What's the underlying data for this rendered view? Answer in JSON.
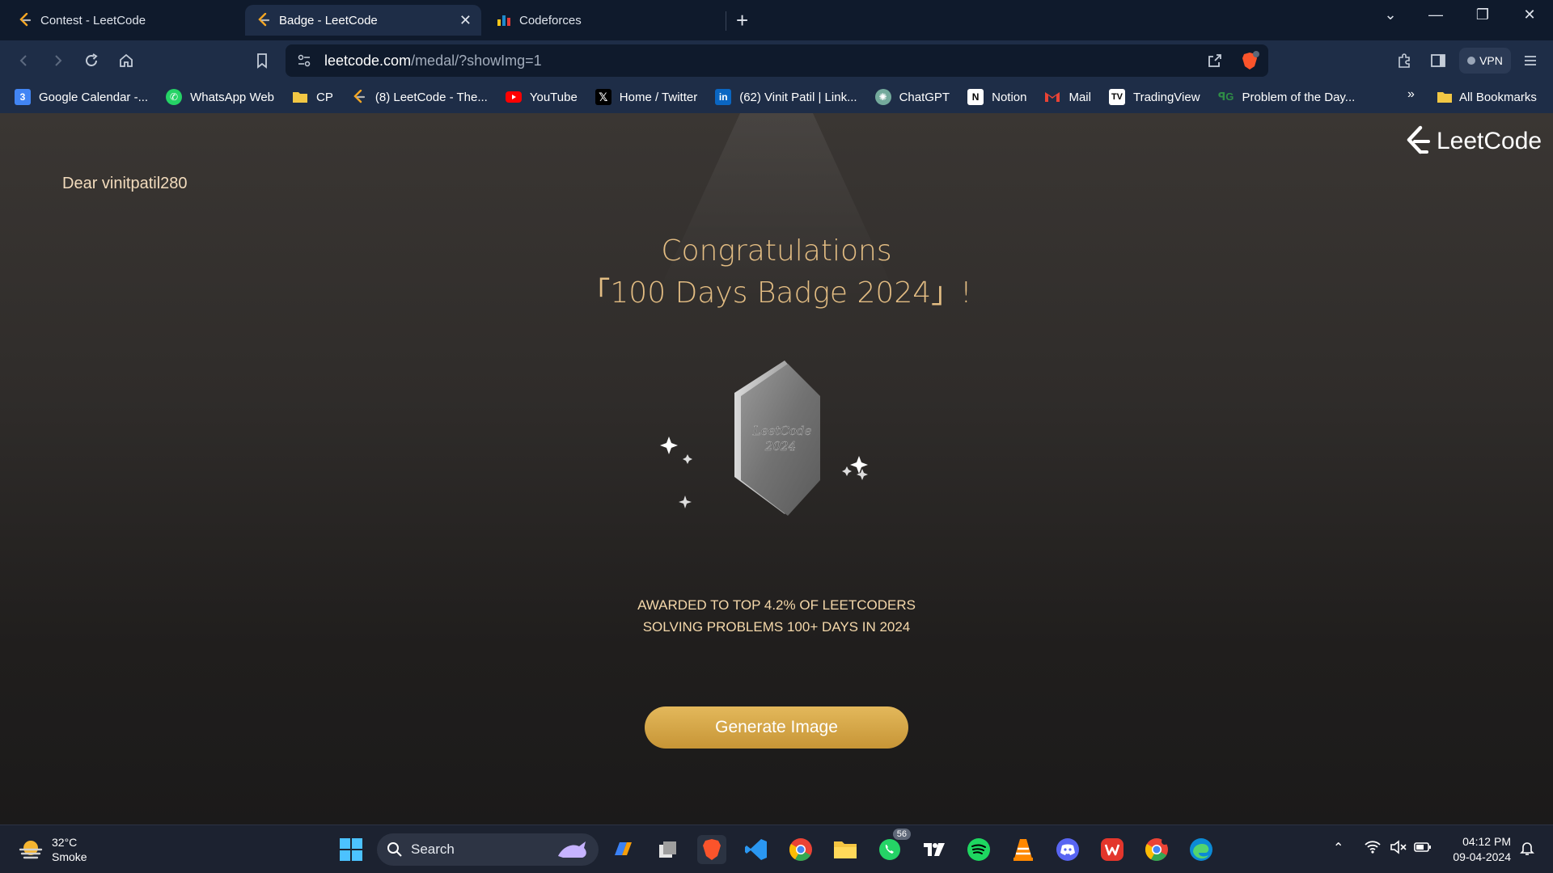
{
  "tabs": [
    {
      "title": "Contest - LeetCode",
      "active": false
    },
    {
      "title": "Badge - LeetCode",
      "active": true
    },
    {
      "title": "Codeforces",
      "active": false
    }
  ],
  "toolbar": {
    "url_host": "leetcode.com",
    "url_path": "/medal/?showImg=1",
    "vpn_label": "VPN"
  },
  "bookmarks": [
    {
      "label": "Google Calendar -...",
      "icon": "calendar-icon",
      "color": "#4285f4"
    },
    {
      "label": "WhatsApp Web",
      "icon": "whatsapp-icon",
      "color": "#25d366"
    },
    {
      "label": "CP",
      "icon": "folder-icon",
      "color": "#f2c744"
    },
    {
      "label": "(8) LeetCode - The...",
      "icon": "leetcode-icon",
      "color": "#f5a623"
    },
    {
      "label": "YouTube",
      "icon": "youtube-icon",
      "color": "#ff0000"
    },
    {
      "label": "Home / Twitter",
      "icon": "x-icon",
      "color": "#000000"
    },
    {
      "label": "(62) Vinit Patil | Link...",
      "icon": "linkedin-icon",
      "color": "#0a66c2"
    },
    {
      "label": "ChatGPT",
      "icon": "chatgpt-icon",
      "color": "#10a37f"
    },
    {
      "label": "Notion",
      "icon": "notion-icon",
      "color": "#ffffff"
    },
    {
      "label": "Mail",
      "icon": "gmail-icon",
      "color": "#ea4335"
    },
    {
      "label": "TradingView",
      "icon": "tradingview-icon",
      "color": "#000000"
    },
    {
      "label": "Problem of the Day...",
      "icon": "gfg-icon",
      "color": "#2f8d46"
    }
  ],
  "bookmarks_more": "»",
  "all_bookmarks": "All Bookmarks",
  "page": {
    "greeting": "Dear vinitpatil280",
    "logo_text": "LeetCode",
    "congrats_line1": "Congratulations",
    "congrats_line2": "「100 Days Badge 2024」!",
    "badge_text_line1": "LeetCode",
    "badge_text_line2": "2024",
    "award_line1": "AWARDED TO TOP 4.2% OF LEETCODERS",
    "award_line2": "SOLVING PROBLEMS 100+ DAYS IN 2024",
    "button_label": "Generate Image",
    "accent_color": "#e3bd83",
    "button_color": "#d7a748"
  },
  "taskbar": {
    "temperature": "32°C",
    "weather": "Smoke",
    "search_label": "Search",
    "whatsapp_badge": "56",
    "time": "04:12 PM",
    "date": "09-04-2024"
  }
}
